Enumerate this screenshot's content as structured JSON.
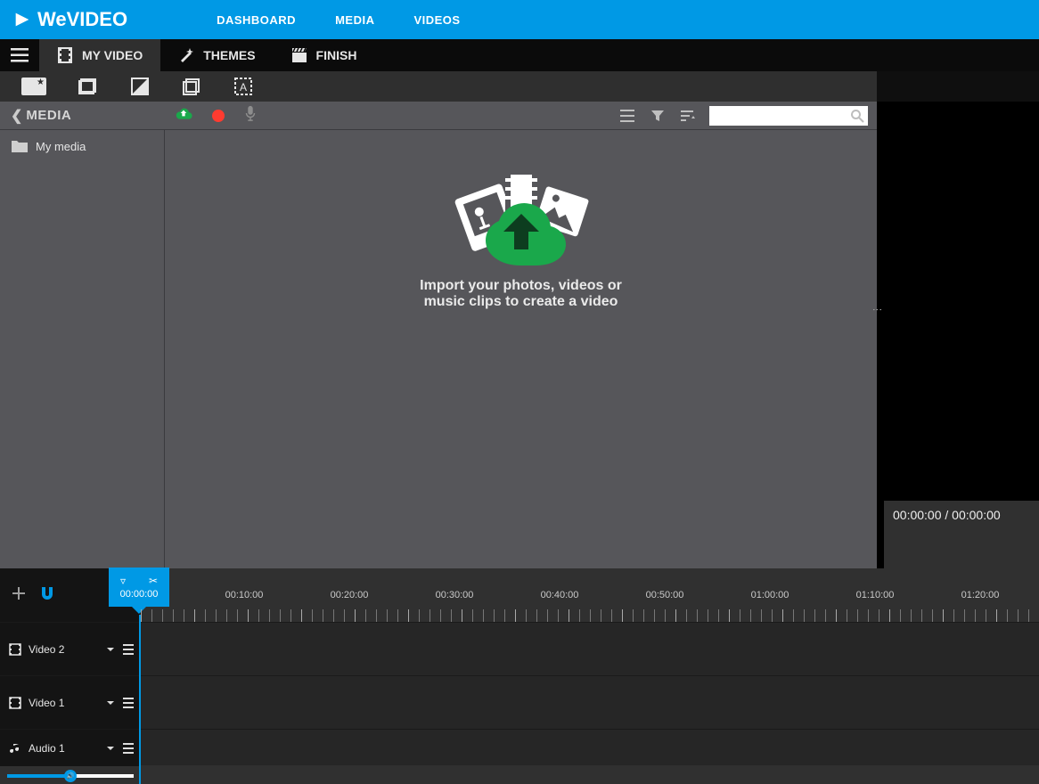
{
  "brand": "WeVIDEO",
  "topnav": [
    "DASHBOARD",
    "MEDIA",
    "VIDEOS"
  ],
  "tabs": {
    "myvideo": "MY VIDEO",
    "themes": "THEMES",
    "finish": "FINISH"
  },
  "media": {
    "back_label": "MEDIA",
    "folder": "My media",
    "drop_line1": "Import your photos, videos or",
    "drop_line2": "music clips to create a video",
    "search_placeholder": ""
  },
  "preview": {
    "time": "00:00:00 / 00:00:00"
  },
  "timeline": {
    "playhead": "00:00:00",
    "labels": [
      "00:10:00",
      "00:20:00",
      "00:30:00",
      "00:40:00",
      "00:50:00",
      "01:00:00",
      "01:10:00",
      "01:20:00"
    ],
    "tracks": {
      "video2": "Video 2",
      "video1": "Video 1",
      "audio1": "Audio 1"
    }
  }
}
